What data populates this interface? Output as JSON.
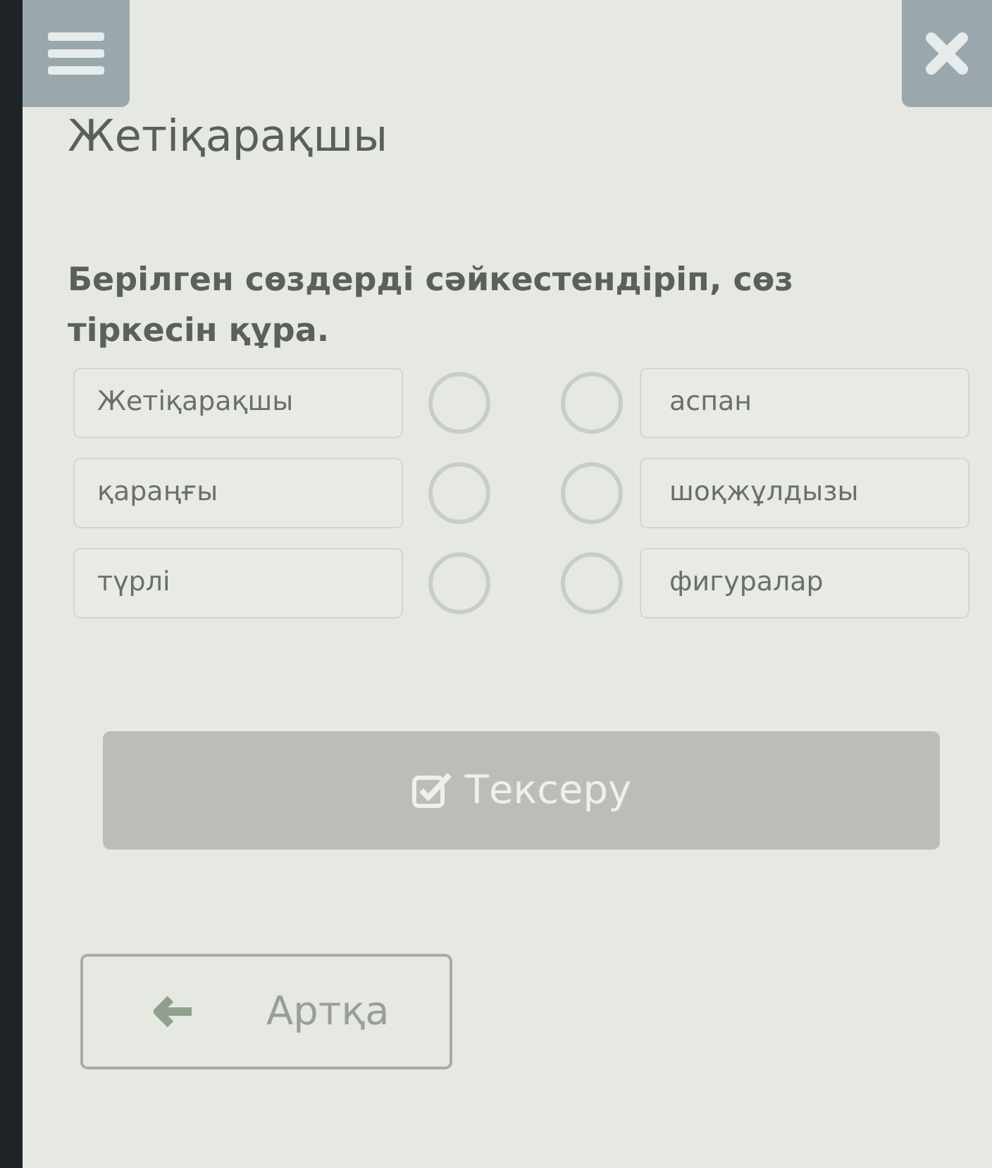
{
  "title": "Жетіқарақшы",
  "question": "Берілген сөздерді сәйкестендіріп, сөз тіркесін құра.",
  "left_items": [
    {
      "label": "Жетіқарақшы"
    },
    {
      "label": "қараңғы"
    },
    {
      "label": "түрлі"
    }
  ],
  "right_items": [
    {
      "label": "аспан"
    },
    {
      "label": "шоқжұлдызы"
    },
    {
      "label": "фигуралар"
    }
  ],
  "check_button": {
    "label": "Тексеру",
    "disabled": true
  },
  "back_button": {
    "label": "Артқа"
  }
}
